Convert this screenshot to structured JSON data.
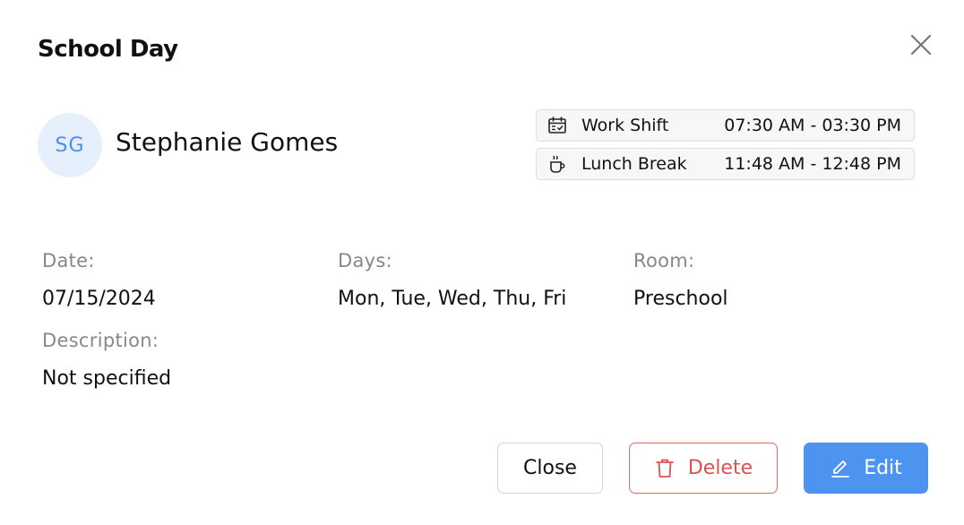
{
  "modal": {
    "title": "School Day",
    "close_icon": "close-icon"
  },
  "person": {
    "initials": "SG",
    "name": "Stephanie Gomes",
    "avatar_bg": "#e6f0fc",
    "avatar_fg": "#4a8ef0"
  },
  "schedule": {
    "work_shift": {
      "icon": "calendar-check-icon",
      "label": "Work Shift",
      "time": "07:30 AM - 03:30 PM"
    },
    "lunch_break": {
      "icon": "coffee-cup-icon",
      "label": "Lunch Break",
      "time": "11:48 AM - 12:48 PM"
    }
  },
  "details": {
    "date_label": "Date:",
    "date_value": "07/15/2024",
    "days_label": "Days:",
    "days_value": "Mon, Tue, Wed, Thu, Fri",
    "room_label": "Room:",
    "room_value": "Preschool",
    "description_label": "Description:",
    "description_value": "Not specified"
  },
  "actions": {
    "close_label": "Close",
    "delete_label": "Delete",
    "delete_icon": "trash-icon",
    "edit_label": "Edit",
    "edit_icon": "pencil-icon",
    "delete_color": "#e05050",
    "edit_color": "#4d94f1"
  }
}
